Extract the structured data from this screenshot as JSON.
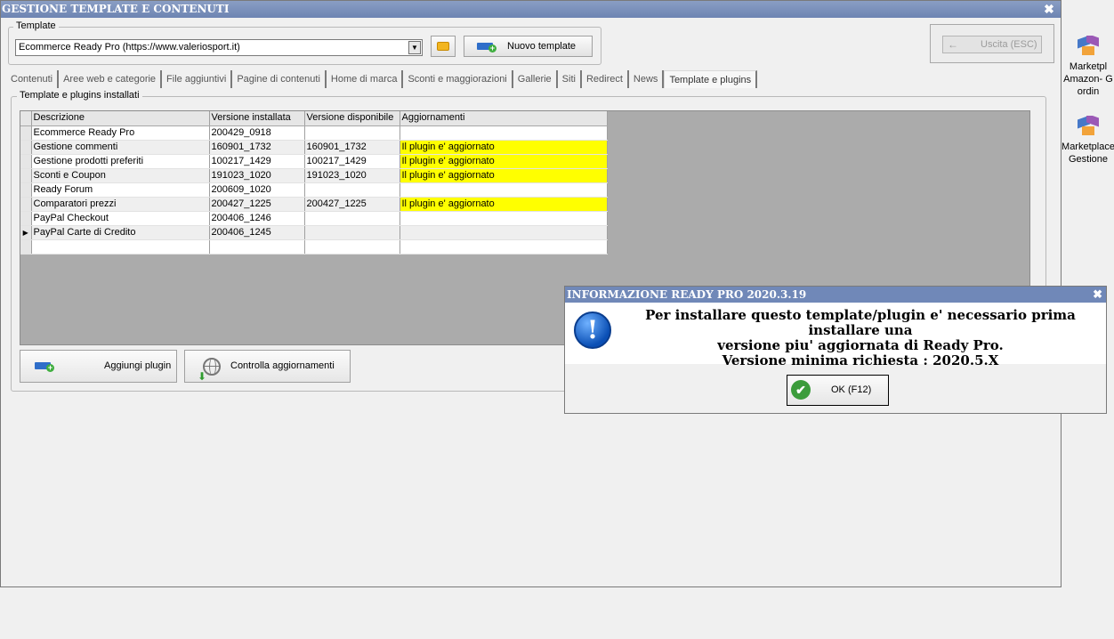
{
  "window": {
    "title": "GESTIONE TEMPLATE E CONTENUTI",
    "close_glyph": "✖"
  },
  "template_group": {
    "label": "Template",
    "selected": "Ecommerce Ready Pro (https://www.valeriosport.it)",
    "new_template_label": "Nuovo template"
  },
  "exit_button": {
    "label": "Uscita (ESC)",
    "arrow_glyph": "←"
  },
  "tabs": [
    {
      "label": "Contenuti"
    },
    {
      "label": "Aree web e categorie"
    },
    {
      "label": "File aggiuntivi"
    },
    {
      "label": "Pagine di contenuti"
    },
    {
      "label": "Home di marca"
    },
    {
      "label": "Sconti e maggiorazioni"
    },
    {
      "label": "Gallerie"
    },
    {
      "label": "Siti"
    },
    {
      "label": "Redirect"
    },
    {
      "label": "News"
    },
    {
      "label": "Template e plugins"
    }
  ],
  "active_tab": "Template e plugins",
  "plugins_group": {
    "label": "Template e plugins installati",
    "columns": [
      "Descrizione",
      "Versione installata",
      "Versione disponibile",
      "Aggiornamenti"
    ],
    "rows": [
      {
        "desc": "Ecommerce Ready Pro",
        "inst": "200429_0918",
        "disp": "",
        "agg": "",
        "highlight": false
      },
      {
        "desc": "Gestione commenti",
        "inst": "160901_1732",
        "disp": "160901_1732",
        "agg": "Il plugin e' aggiornato",
        "highlight": true
      },
      {
        "desc": "Gestione prodotti preferiti",
        "inst": "100217_1429",
        "disp": "100217_1429",
        "agg": "Il plugin e' aggiornato",
        "highlight": true
      },
      {
        "desc": "Sconti e Coupon",
        "inst": "191023_1020",
        "disp": "191023_1020",
        "agg": "Il plugin e' aggiornato",
        "highlight": true
      },
      {
        "desc": "Ready Forum",
        "inst": "200609_1020",
        "disp": "",
        "agg": "",
        "highlight": false
      },
      {
        "desc": "Comparatori prezzi",
        "inst": "200427_1225",
        "disp": "200427_1225",
        "agg": "Il plugin e' aggiornato",
        "highlight": true
      },
      {
        "desc": "PayPal Checkout",
        "inst": "200406_1246",
        "disp": "",
        "agg": "",
        "highlight": false
      },
      {
        "desc": "PayPal Carte di Credito",
        "inst": "200406_1245",
        "disp": "",
        "agg": "",
        "highlight": false
      },
      {
        "desc": "",
        "inst": "",
        "disp": "",
        "agg": "",
        "highlight": false
      }
    ],
    "current_row_marker": "▶",
    "add_plugin_label": "Aggiungi plugin",
    "check_updates_label": "Controlla aggiornamenti"
  },
  "side_items": [
    {
      "label": "Marketpl Amazon- G ordin"
    },
    {
      "label": "Marketplace Gestione"
    }
  ],
  "dialog": {
    "title": "INFORMAZIONE READY PRO 2020.3.19",
    "close_glyph": "✖",
    "icon_glyph": "!",
    "message_line1": "Per installare questo template/plugin e' necessario prima installare una",
    "message_line2": "versione piu' aggiornata di Ready Pro.",
    "message_line3": "Versione minima richiesta : 2020.5.X",
    "ok_label": "OK (F12)",
    "ok_glyph": "✔"
  },
  "colors": {
    "highlight": "#ffff00",
    "title_bar": "#6d84b2",
    "grid_background": "#ababab"
  }
}
